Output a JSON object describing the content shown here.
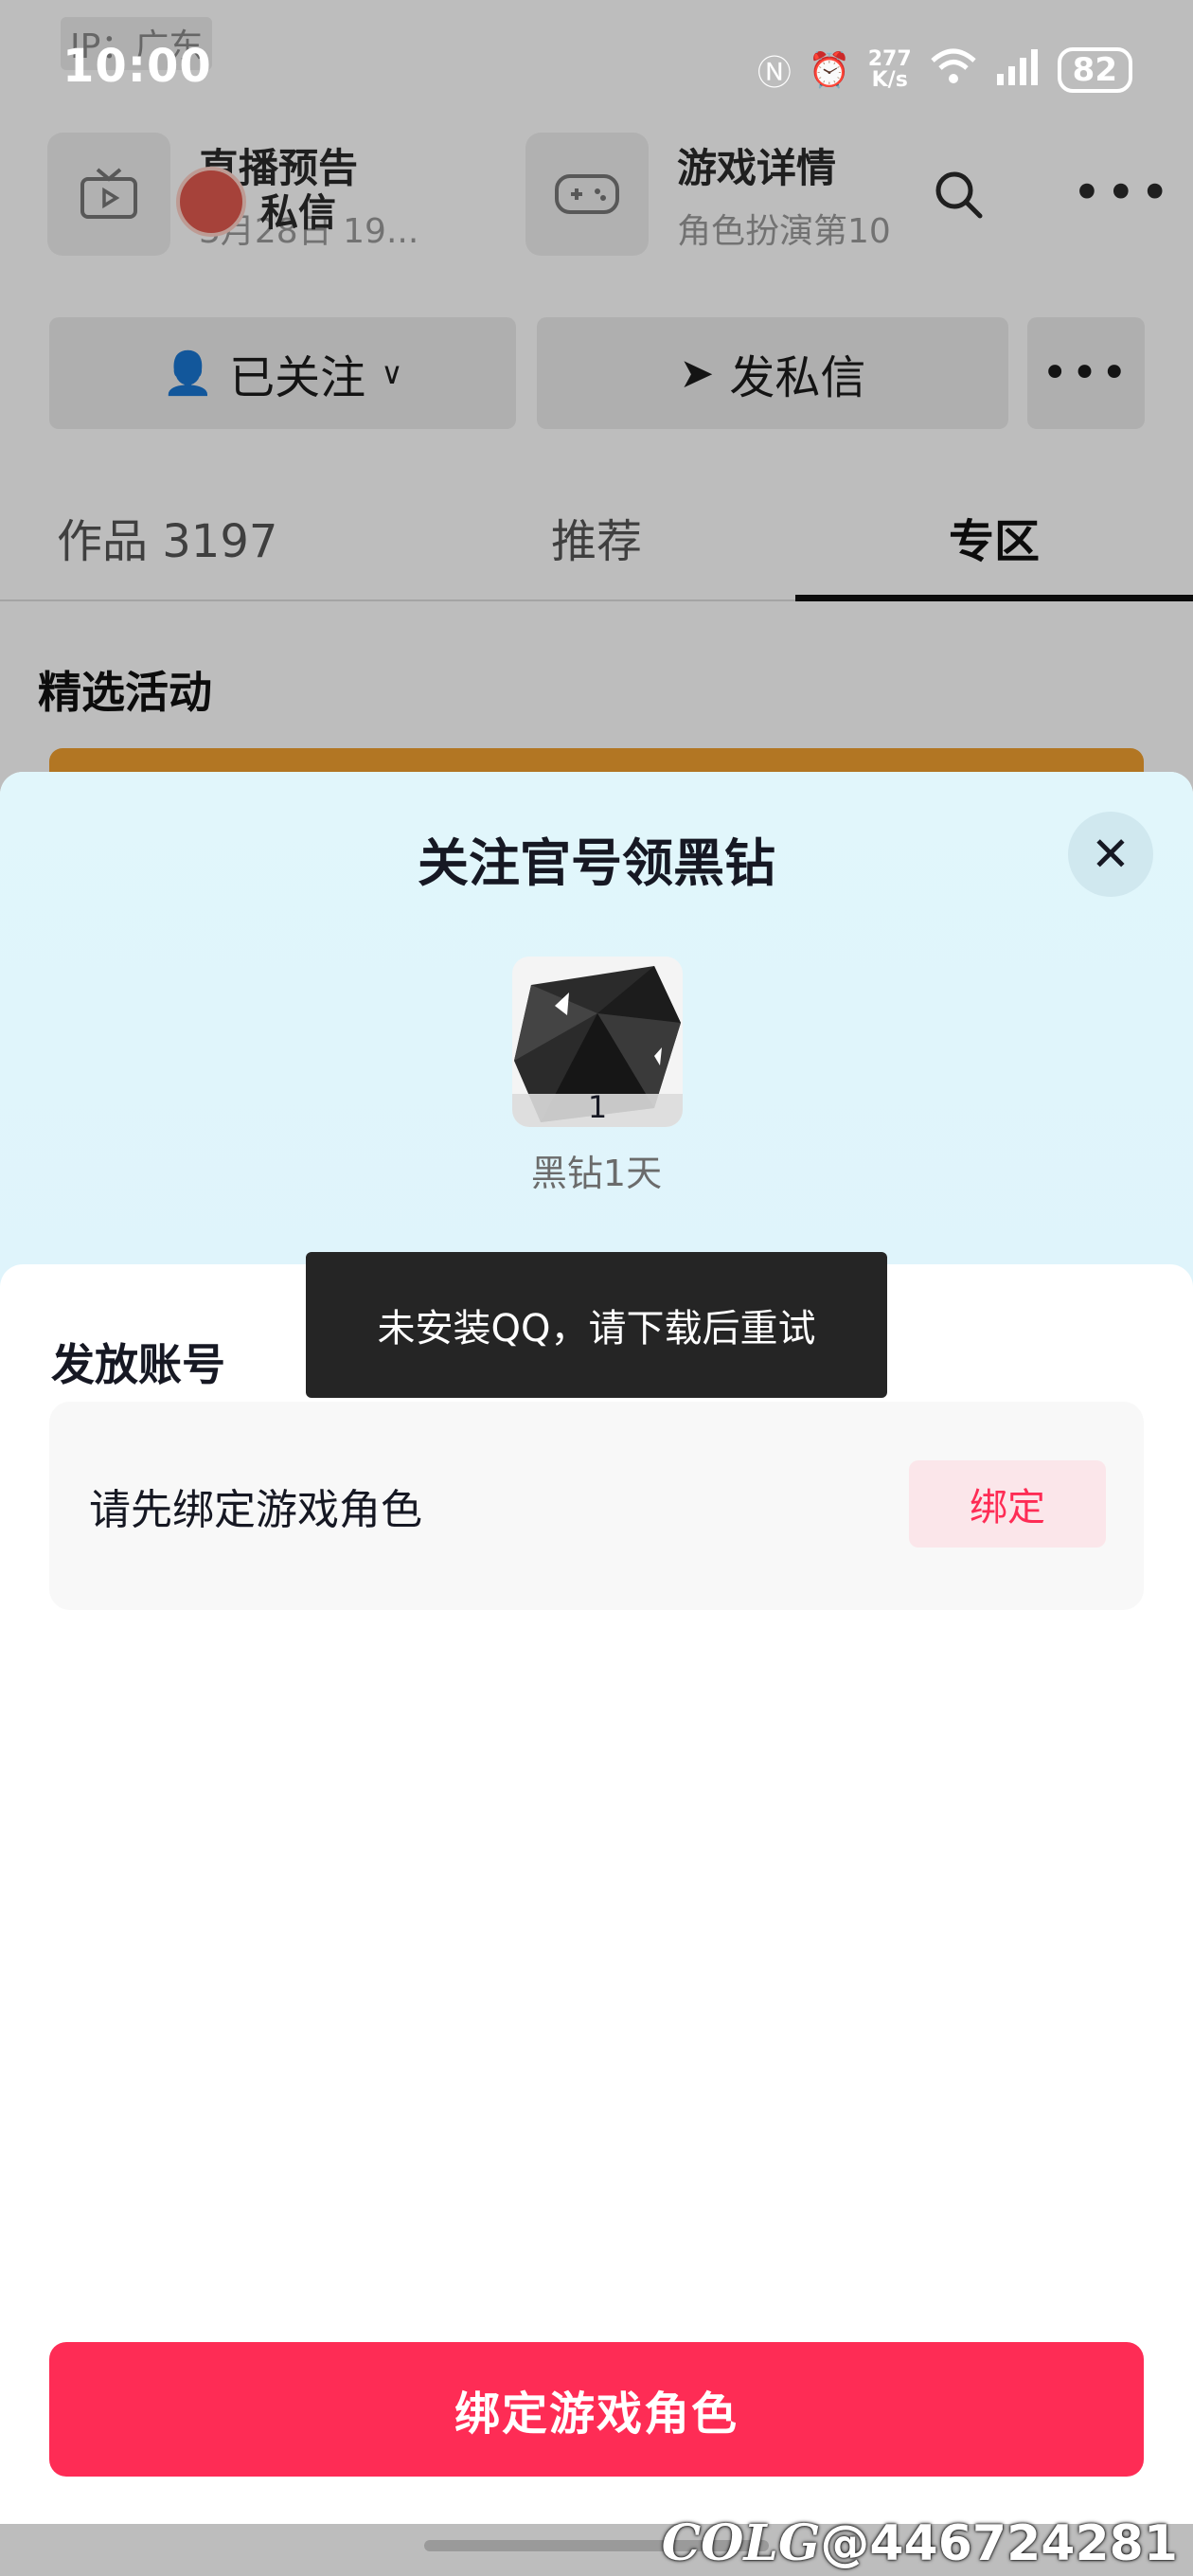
{
  "status_bar": {
    "ip_label": "IP：广东",
    "time": "10:00",
    "net_speed_value": "277",
    "net_speed_unit": "K/s",
    "battery": "82"
  },
  "header": {
    "live_card": {
      "title": "直播预告",
      "subtitle": "3月28日 19..."
    },
    "private_message_label": "私信",
    "game_card": {
      "title": "游戏详情",
      "subtitle": "角色扮演第10"
    }
  },
  "actions": {
    "follow_label": "已关注",
    "message_label": "发私信"
  },
  "tabs": [
    {
      "label": "作品 3197"
    },
    {
      "label": "推荐"
    },
    {
      "label": "专区"
    }
  ],
  "section": {
    "title": "精选活动"
  },
  "sheet": {
    "title": "关注官号领黑钻",
    "reward": {
      "count": "1",
      "name": "黑钻1天"
    },
    "account_label": "发放账号",
    "bind_hint": "请先绑定游戏角色",
    "bind_button": "绑定",
    "primary_button": "绑定游戏角色"
  },
  "toast": {
    "message": "未安装QQ，请下载后重试"
  },
  "watermark": {
    "logo": "COLG",
    "text": "@446724281"
  },
  "colors": {
    "accent": "#fe2c55",
    "sheet_top": "#e1f6fb",
    "toast_bg": "#252525"
  }
}
